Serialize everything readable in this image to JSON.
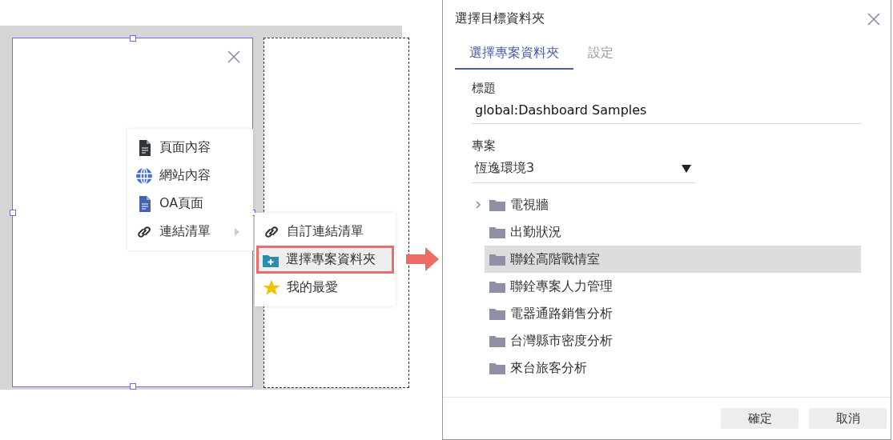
{
  "canvas": {
    "widget": {
      "selected": true
    },
    "menu": {
      "items": [
        {
          "kind": "document-dark",
          "label": "頁面內容",
          "submenu": false
        },
        {
          "kind": "globe",
          "label": "網站內容",
          "submenu": false
        },
        {
          "kind": "document-blue",
          "label": "OA頁面",
          "submenu": false
        },
        {
          "kind": "link",
          "label": "連結清單",
          "submenu": true
        }
      ]
    },
    "submenu": {
      "items": [
        {
          "kind": "link",
          "label": "自訂連結清單",
          "highlighted": false
        },
        {
          "kind": "folder-plus",
          "label": "選擇專案資料夾",
          "highlighted": true
        },
        {
          "kind": "star",
          "label": "我的最愛",
          "highlighted": false
        }
      ]
    }
  },
  "dialog": {
    "title": "選擇目標資料夾",
    "tabs": [
      {
        "label": "選擇專案資料夾",
        "selected": true
      },
      {
        "label": "設定",
        "selected": false
      }
    ],
    "title_field": {
      "label": "標題",
      "value": "global:Dashboard Samples"
    },
    "project_field": {
      "label": "專案",
      "value": "恆逸環境3"
    },
    "folders": [
      {
        "label": "電視牆",
        "expandable": true,
        "selected": false
      },
      {
        "label": "出勤狀況",
        "expandable": false,
        "selected": false
      },
      {
        "label": "聯銓高階戰情室",
        "expandable": false,
        "selected": true
      },
      {
        "label": "聯銓專案人力管理",
        "expandable": false,
        "selected": false
      },
      {
        "label": "電器通路銷售分析",
        "expandable": false,
        "selected": false
      },
      {
        "label": "台灣縣市密度分析",
        "expandable": false,
        "selected": false
      },
      {
        "label": "來台旅客分析",
        "expandable": false,
        "selected": false
      }
    ],
    "buttons": [
      "確定",
      "取消"
    ]
  }
}
